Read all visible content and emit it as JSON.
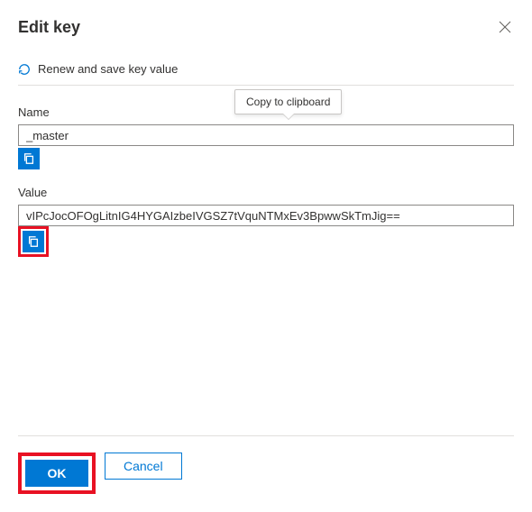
{
  "dialog": {
    "title": "Edit key"
  },
  "toolbar": {
    "renew_label": "Renew and save key value"
  },
  "tooltip": {
    "text": "Copy to clipboard"
  },
  "fields": {
    "name": {
      "label": "Name",
      "value": "_master"
    },
    "value": {
      "label": "Value",
      "value": "vIPcJocOFOgLitnIG4HYGAIzbeIVGSZ7tVquNTMxEv3BpwwSkTmJig=="
    }
  },
  "buttons": {
    "ok_label": "OK",
    "cancel_label": "Cancel"
  }
}
